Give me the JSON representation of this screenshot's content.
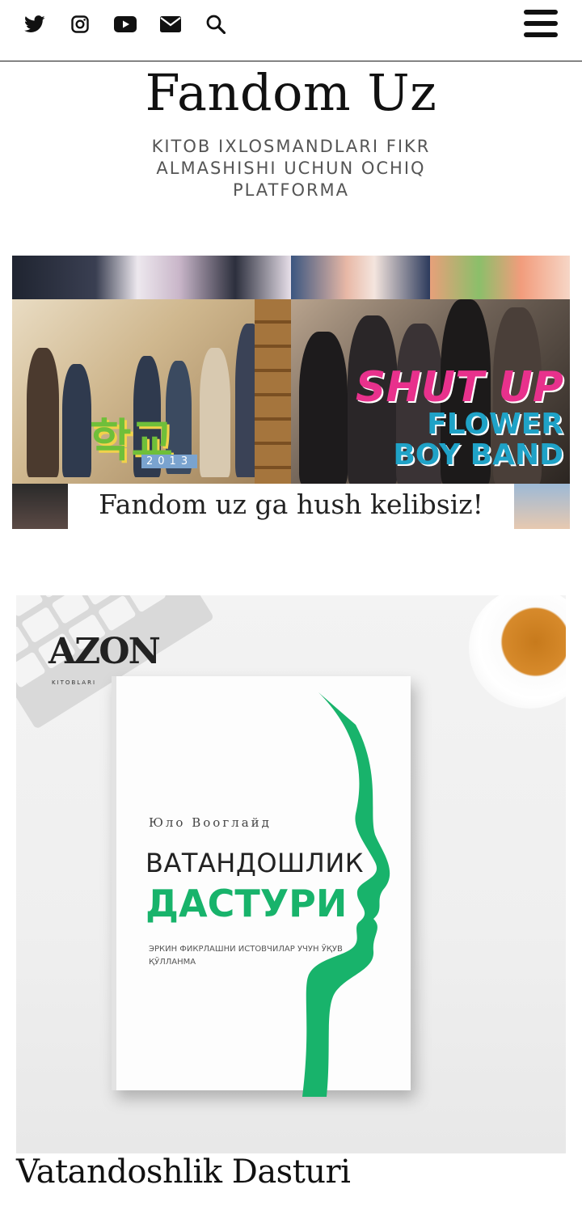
{
  "header": {
    "social_icons": [
      "twitter-icon",
      "instagram-icon",
      "youtube-icon",
      "envelope-icon",
      "search-icon"
    ],
    "menu_icon": "hamburger-menu-icon"
  },
  "site": {
    "title": "Fandom Uz",
    "tagline": "KITOB IXLOSMANDLARI FIKR ALMASHISHI UCHUN OCHIQ PLATFORMA"
  },
  "hero": {
    "left_poster_logo": "학교",
    "left_poster_year": "2013",
    "right_poster_line1": "SHUT UP",
    "right_poster_line2": "FLOWER",
    "right_poster_line3": "BOY BAND",
    "welcome": "Fandom uz ga hush kelibsiz!"
  },
  "post": {
    "cover": {
      "brand": "AZON",
      "brand_sub": "KITOBLARI",
      "author": "Юло Вооглайд",
      "title_line1": "ВАТАНДОШЛИК",
      "title_line2": "ДАСТУРИ",
      "subtitle": "ЭРКИН ФИКРЛАШНИ ИСТОВЧИЛАР УЧУН ЎҚУВ ҚЎЛЛАНМА"
    },
    "title": "Vatandoshlik Dasturi"
  },
  "colors": {
    "accent_green": "#18b36b",
    "shutup_pink": "#e8318c",
    "shutup_blue": "#1fa2c7",
    "text": "#111111",
    "tagline": "#555555"
  }
}
